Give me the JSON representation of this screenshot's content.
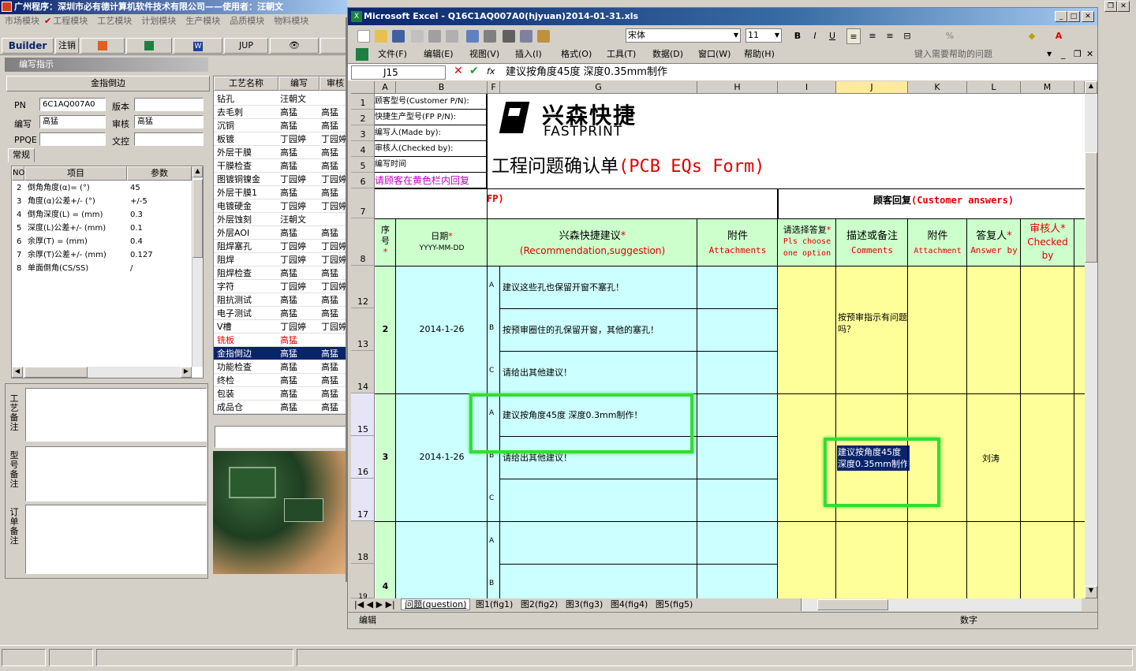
{
  "app": {
    "title": "广州程序：深圳市必有德计算机软件技术有限公司——使用者：汪朝文",
    "menu": [
      "市场模块",
      "工程模块",
      "工艺模块",
      "计划模块",
      "生产模块",
      "品质模块",
      "物料模块"
    ],
    "toolbar": [
      "Builder",
      "注销",
      "JUP"
    ],
    "panel_title": "编写指示",
    "form_header": "金指倒边",
    "pn_label": "PN",
    "pn_value": "6C1AQ007A0",
    "version_label": "版本",
    "version_value": "",
    "editor_label": "编写",
    "editor_value": "高猛",
    "reviewer_label": "审核",
    "reviewer_value": "高猛",
    "ppqe_label": "PPQE",
    "ppqe_value": "",
    "control_label": "文控",
    "control_value": "",
    "tab_label": "常规",
    "param_headers": {
      "no": "NO",
      "item": "项目",
      "value": "参数"
    },
    "params": [
      {
        "no": "2",
        "item": "倒角角度(α)=  (°)",
        "value": "45"
      },
      {
        "no": "3",
        "item": "角度(α)公差+/-  (°)",
        "value": "+/-5"
      },
      {
        "no": "4",
        "item": "倒角深度(L) =  (mm)",
        "value": "0.3"
      },
      {
        "no": "5",
        "item": "深度(L)公差+/-  (mm)",
        "value": "0.1"
      },
      {
        "no": "6",
        "item": "余厚(T) =  (mm)",
        "value": "0.4"
      },
      {
        "no": "7",
        "item": "余厚(T)公差+/-  (mm)",
        "value": "0.127"
      },
      {
        "no": "8",
        "item": "单面倒角(CS/SS)",
        "value": "/"
      }
    ],
    "process_headers": {
      "name": "工艺名称",
      "editor": "编写",
      "reviewer": "审核"
    },
    "processes": [
      {
        "name": "钻孔",
        "editor": "汪朝文",
        "reviewer": ""
      },
      {
        "name": "去毛刺",
        "editor": "高猛",
        "reviewer": "高猛"
      },
      {
        "name": "沉铜",
        "editor": "高猛",
        "reviewer": "高猛"
      },
      {
        "name": "板镀",
        "editor": "丁园婷",
        "reviewer": "丁园婷"
      },
      {
        "name": "外层干膜",
        "editor": "高猛",
        "reviewer": "高猛"
      },
      {
        "name": "干膜检查",
        "editor": "高猛",
        "reviewer": "高猛"
      },
      {
        "name": "图镀铜镍金",
        "editor": "丁园婷",
        "reviewer": "丁园婷"
      },
      {
        "name": "外层干膜1",
        "editor": "高猛",
        "reviewer": "高猛"
      },
      {
        "name": "电镀硬金",
        "editor": "丁园婷",
        "reviewer": "丁园婷"
      },
      {
        "name": "外层蚀刻",
        "editor": "汪朝文",
        "reviewer": ""
      },
      {
        "name": "外层AOI",
        "editor": "高猛",
        "reviewer": "高猛"
      },
      {
        "name": "阻焊塞孔",
        "editor": "丁园婷",
        "reviewer": "丁园婷"
      },
      {
        "name": "阻焊",
        "editor": "丁园婷",
        "reviewer": "丁园婷"
      },
      {
        "name": "阻焊检查",
        "editor": "高猛",
        "reviewer": "高猛"
      },
      {
        "name": "字符",
        "editor": "丁园婷",
        "reviewer": "丁园婷"
      },
      {
        "name": "阻抗测试",
        "editor": "高猛",
        "reviewer": "高猛"
      },
      {
        "name": "电子测试",
        "editor": "高猛",
        "reviewer": "高猛"
      },
      {
        "name": "V槽",
        "editor": "丁园婷",
        "reviewer": "丁园婷"
      },
      {
        "name": "铣板",
        "editor": "高猛",
        "reviewer": ""
      },
      {
        "name": "金指倒边",
        "editor": "高猛",
        "reviewer": "高猛"
      },
      {
        "name": "功能检查",
        "editor": "高猛",
        "reviewer": "高猛"
      },
      {
        "name": "终检",
        "editor": "高猛",
        "reviewer": "高猛"
      },
      {
        "name": "包装",
        "editor": "高猛",
        "reviewer": "高猛"
      },
      {
        "name": "成品仓",
        "editor": "高猛",
        "reviewer": "高猛"
      }
    ],
    "notes": {
      "process": "工艺备注",
      "model": "型号备注",
      "order": "订单备注"
    }
  },
  "excel": {
    "title": "Microsoft Excel - Q16C1AQ007A0(hjyuan)2014-01-31.xls",
    "font_name": "宋体",
    "font_size": "11",
    "menu": [
      "文件(F)",
      "编辑(E)",
      "视图(V)",
      "插入(I)",
      "格式(O)",
      "工具(T)",
      "数据(D)",
      "窗口(W)",
      "帮助(H)"
    ],
    "help_placeholder": "键入需要帮助的问题",
    "cell_ref": "J15",
    "formula": "建议按角度45度 深度0.35mm制作",
    "columns": [
      "A",
      "B",
      "F",
      "G",
      "H",
      "I",
      "J",
      "K",
      "L",
      "M"
    ],
    "rows": [
      "1",
      "2",
      "3",
      "4",
      "5",
      "6",
      "7",
      "8",
      "12",
      "13",
      "14",
      "15",
      "16",
      "17",
      "18"
    ],
    "info_labels": [
      "顾客型号(Customer P/N):",
      "快捷生产型号(FP P/N):",
      "编写人(Made by):",
      "审核人(Checked by):",
      "编写时间",
      "请顾客在黄色栏内回复"
    ],
    "logo_cn": "兴森快捷",
    "logo_en": "FASTPRINT",
    "form_title_cn": "工程问题确认单",
    "form_title_en": "(PCB EQs Form)",
    "fp_tag": "FP)",
    "customer_reply": "顾客回复",
    "customer_reply_en": "(Customer answers)",
    "headers": {
      "seq": "序号",
      "date": "日期",
      "date_fmt": "YYYY-MM-DD",
      "suggestion": "兴森快捷建议",
      "suggestion_en": "(Recommendation,suggestion)",
      "attach": "附件",
      "attach_en": "Attachments",
      "choose": "请选择答复",
      "choose_en": "Pls choose one option",
      "comments": "描述或备注",
      "comments_en": "Comments",
      "attach2": "附件",
      "attach2_en": "Attachment",
      "answer": "答复人",
      "answer_en": "Answer by",
      "checked": "审核人",
      "checked_en": "Checked by"
    },
    "items": [
      {
        "seq": "2",
        "date": "2014-1-26",
        "options": [
          {
            "letter": "A",
            "text": "建议这些孔也保留开窗不塞孔！"
          },
          {
            "letter": "B",
            "text": "按预审圈住的孔保留开窗，其他的塞孔！"
          },
          {
            "letter": "C",
            "text": "请给出其他建议！"
          }
        ],
        "comment": "按预审指示有问题吗？"
      },
      {
        "seq": "3",
        "date": "2014-1-26",
        "options": [
          {
            "letter": "A",
            "text": "建议按角度45度 深度0.3mm制作！"
          },
          {
            "letter": "B",
            "text": "请给出其他建议！"
          },
          {
            "letter": "C",
            "text": ""
          }
        ],
        "comment": "建议按角度45度深度0.35mm制作",
        "comment_line1": "建议按角度45度",
        "comment_line2": "深度0.35mm制作",
        "answer": "刘涛"
      },
      {
        "seq": "4",
        "date": "",
        "options": [
          {
            "letter": "A",
            "text": ""
          },
          {
            "letter": "B",
            "text": ""
          }
        ]
      }
    ],
    "sheet_tabs": [
      "问题(question)",
      "图1(fig1)",
      "图2(fig2)",
      "图3(fig3)",
      "图4(fig4)",
      "图5(fig5)"
    ],
    "status_left": "编辑",
    "status_right": "数字",
    "row18_label": "18",
    "row19_partial": "19"
  },
  "colors": {
    "title_bar": "#0a246a",
    "highlight_green": "#33dd33",
    "cell_green": "#ccffcc",
    "cell_cyan": "#ccffff",
    "cell_yellow": "#ffff99",
    "label_red": "#e00000"
  }
}
